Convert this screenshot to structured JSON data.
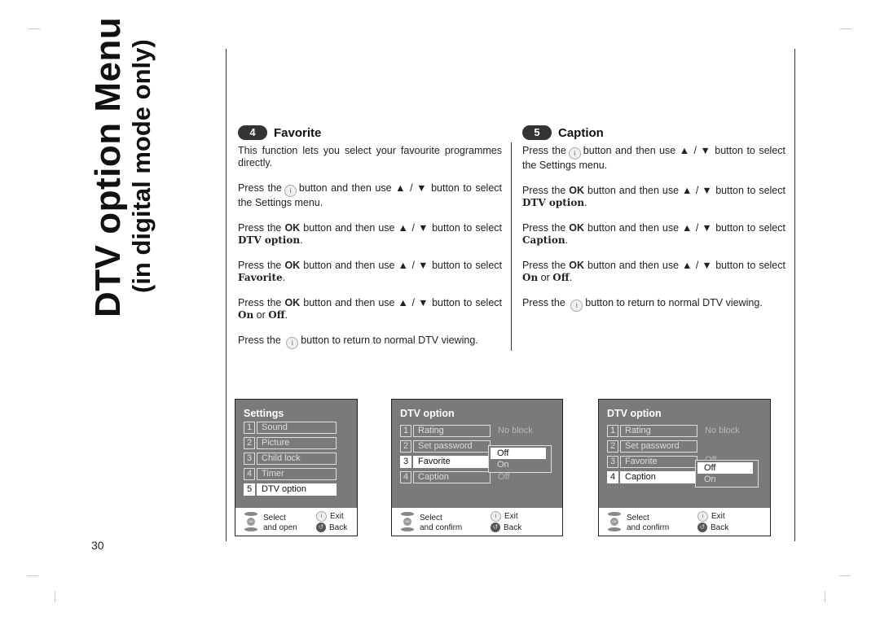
{
  "page": {
    "title_main": "DTV  option Menu",
    "title_sub": "(in digital mode only)",
    "page_number": "30"
  },
  "sections": [
    {
      "badge": "4",
      "title": "Favorite",
      "intro": "This function lets you select your favourite programmes directly.",
      "steps": [
        {
          "pre": "Press the",
          "button": "i",
          "post": "button and then use ▲ / ▼ button to select the Settings menu."
        },
        {
          "pre": "Press the",
          "ok": "OK",
          "post": "button and then use ▲ / ▼ button to select",
          "target": "DTV option",
          "end": "."
        },
        {
          "pre": "Press the",
          "ok": "OK",
          "post": "button and then use ▲ / ▼ button to select",
          "target": "Favorite",
          "end": "."
        },
        {
          "pre": "Press the",
          "ok": "OK",
          "post": "button and then use ▲ / ▼ button to select",
          "target": "On",
          "mid": "or",
          "target2": "Off",
          "end": "."
        },
        {
          "pre": "Press the",
          "button": "i",
          "post": "button to return to normal DTV viewing."
        }
      ]
    },
    {
      "badge": "5",
      "title": "Caption",
      "steps": [
        {
          "pre": "Press the",
          "button": "i",
          "post": "button and then use ▲ / ▼ button to select the Settings menu."
        },
        {
          "pre": "Press the",
          "ok": "OK",
          "post": "button and then use ▲ / ▼ button to select",
          "target": "DTV option",
          "end": "."
        },
        {
          "pre": "Press the",
          "ok": "OK",
          "post": "button and then use ▲ / ▼ button to select",
          "target": "Caption",
          "end": "."
        },
        {
          "pre": "Press the",
          "ok": "OK",
          "post": "button and then use ▲ / ▼ button to select",
          "target": "On",
          "mid": "or",
          "target2": "Off",
          "end": "."
        },
        {
          "pre": "Press the",
          "button": "i",
          "post": "button to return to normal DTV viewing."
        }
      ]
    }
  ],
  "osd_settings": {
    "title": "Settings",
    "items": [
      {
        "num": "1",
        "label": "Sound"
      },
      {
        "num": "2",
        "label": "Picture"
      },
      {
        "num": "3",
        "label": "Child lock"
      },
      {
        "num": "4",
        "label": "Timer"
      },
      {
        "num": "5",
        "label": "DTV option",
        "selected": true
      }
    ],
    "footer": {
      "select_line1": "Select",
      "select_line2": "and open",
      "exit": "Exit",
      "back": "Back",
      "ok_label": "OK",
      "i_label": "i"
    }
  },
  "osd_favorite": {
    "title": "DTV option",
    "items": [
      {
        "num": "1",
        "label": "Rating",
        "value": "No block"
      },
      {
        "num": "2",
        "label": "Set password",
        "value": ""
      },
      {
        "num": "3",
        "label": "Favorite",
        "value": "",
        "selected": true
      },
      {
        "num": "4",
        "label": "Caption",
        "value": "Off"
      }
    ],
    "popup": [
      {
        "label": "Off",
        "selected": true
      },
      {
        "label": "On"
      }
    ],
    "footer": {
      "select_line1": "Select",
      "select_line2": "and confirm",
      "exit": "Exit",
      "back": "Back",
      "ok_label": "OK",
      "i_label": "i"
    }
  },
  "osd_caption": {
    "title": "DTV option",
    "items": [
      {
        "num": "1",
        "label": "Rating",
        "value": "No block"
      },
      {
        "num": "2",
        "label": "Set password",
        "value": ""
      },
      {
        "num": "3",
        "label": "Favorite",
        "value": "Off"
      },
      {
        "num": "4",
        "label": "Caption",
        "value": "",
        "selected": true
      }
    ],
    "popup": [
      {
        "label": "Off",
        "selected": true
      },
      {
        "label": "On"
      }
    ],
    "footer": {
      "select_line1": "Select",
      "select_line2": "and confirm",
      "exit": "Exit",
      "back": "Back",
      "ok_label": "OK",
      "i_label": "i"
    }
  }
}
